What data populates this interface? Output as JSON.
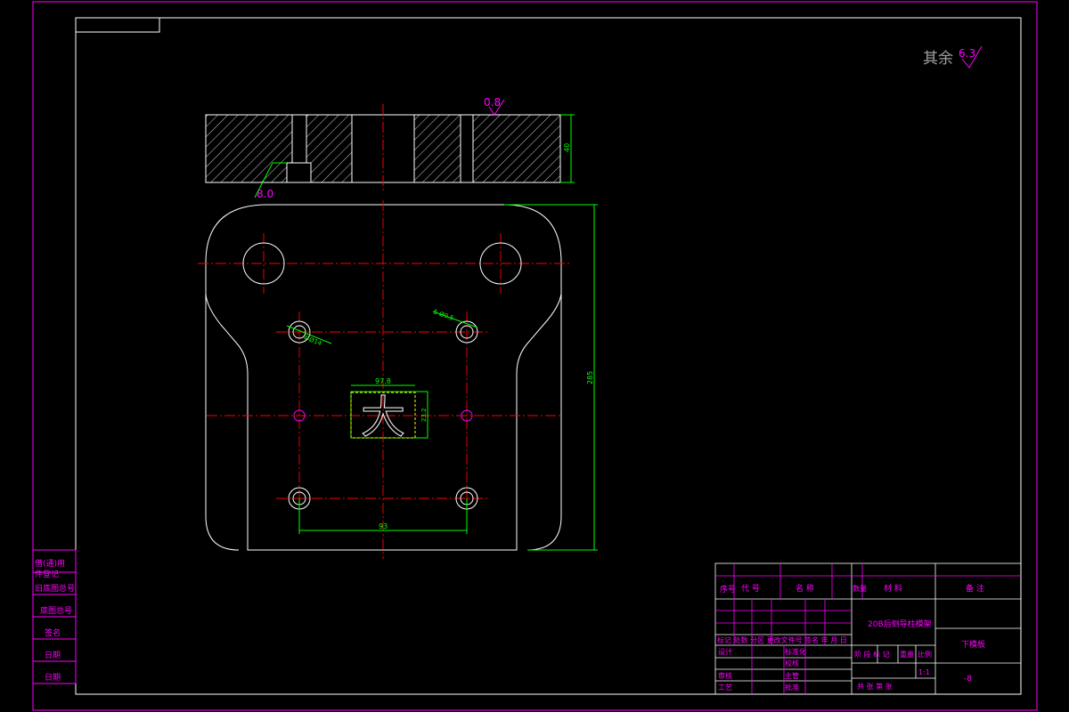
{
  "drawing": {
    "roughness_note": "其余",
    "roughness_value": "6.3",
    "section_roughness": "0.8",
    "counterbore_roughness": "8.0",
    "dim_thickness": "40",
    "dim_height": "285",
    "dim_hole_span": "93",
    "dim_slot_width": "97.8",
    "dim_slot_height": "23.2",
    "hole_callout_1": "4-Ø14",
    "hole_callout_2": "5-Ø9.5",
    "punch_shape_glyph": "大"
  },
  "left_panel": {
    "rows": [
      "借(通)用",
      "件登记",
      "旧底图总号",
      "底图总号",
      "签名",
      "日期",
      "日期"
    ]
  },
  "title_block": {
    "header": {
      "seq": "序号",
      "code": "代 号",
      "name": "名 称",
      "qty": "数量",
      "material": "材 料",
      "remark": "备 注"
    },
    "part_title": "20B后侧导柱模架",
    "part_name": "下模板",
    "revision_row": "标记 处数 分区 更改文件号 签名 年 月 日",
    "roles": {
      "design": "设计",
      "check": "审核",
      "process": "工艺",
      "standardize": "标准化",
      "proofread": "校核",
      "approve_main": "主管",
      "approve": "批准"
    },
    "stage_row": "阶 段 标 记",
    "weight": "重量",
    "scale_label": "比例",
    "scale": "1:1",
    "sheets": "共 张 第 张",
    "drawing_no": "-8"
  },
  "colors": {
    "outline": "#ffffff",
    "centerline": "#ff0000",
    "dimension": "#00ff00",
    "frame": "#ff00ff",
    "annotation": "#ff00ff",
    "gray_text": "#a0a0a0",
    "slot_box": "#ffff00"
  }
}
